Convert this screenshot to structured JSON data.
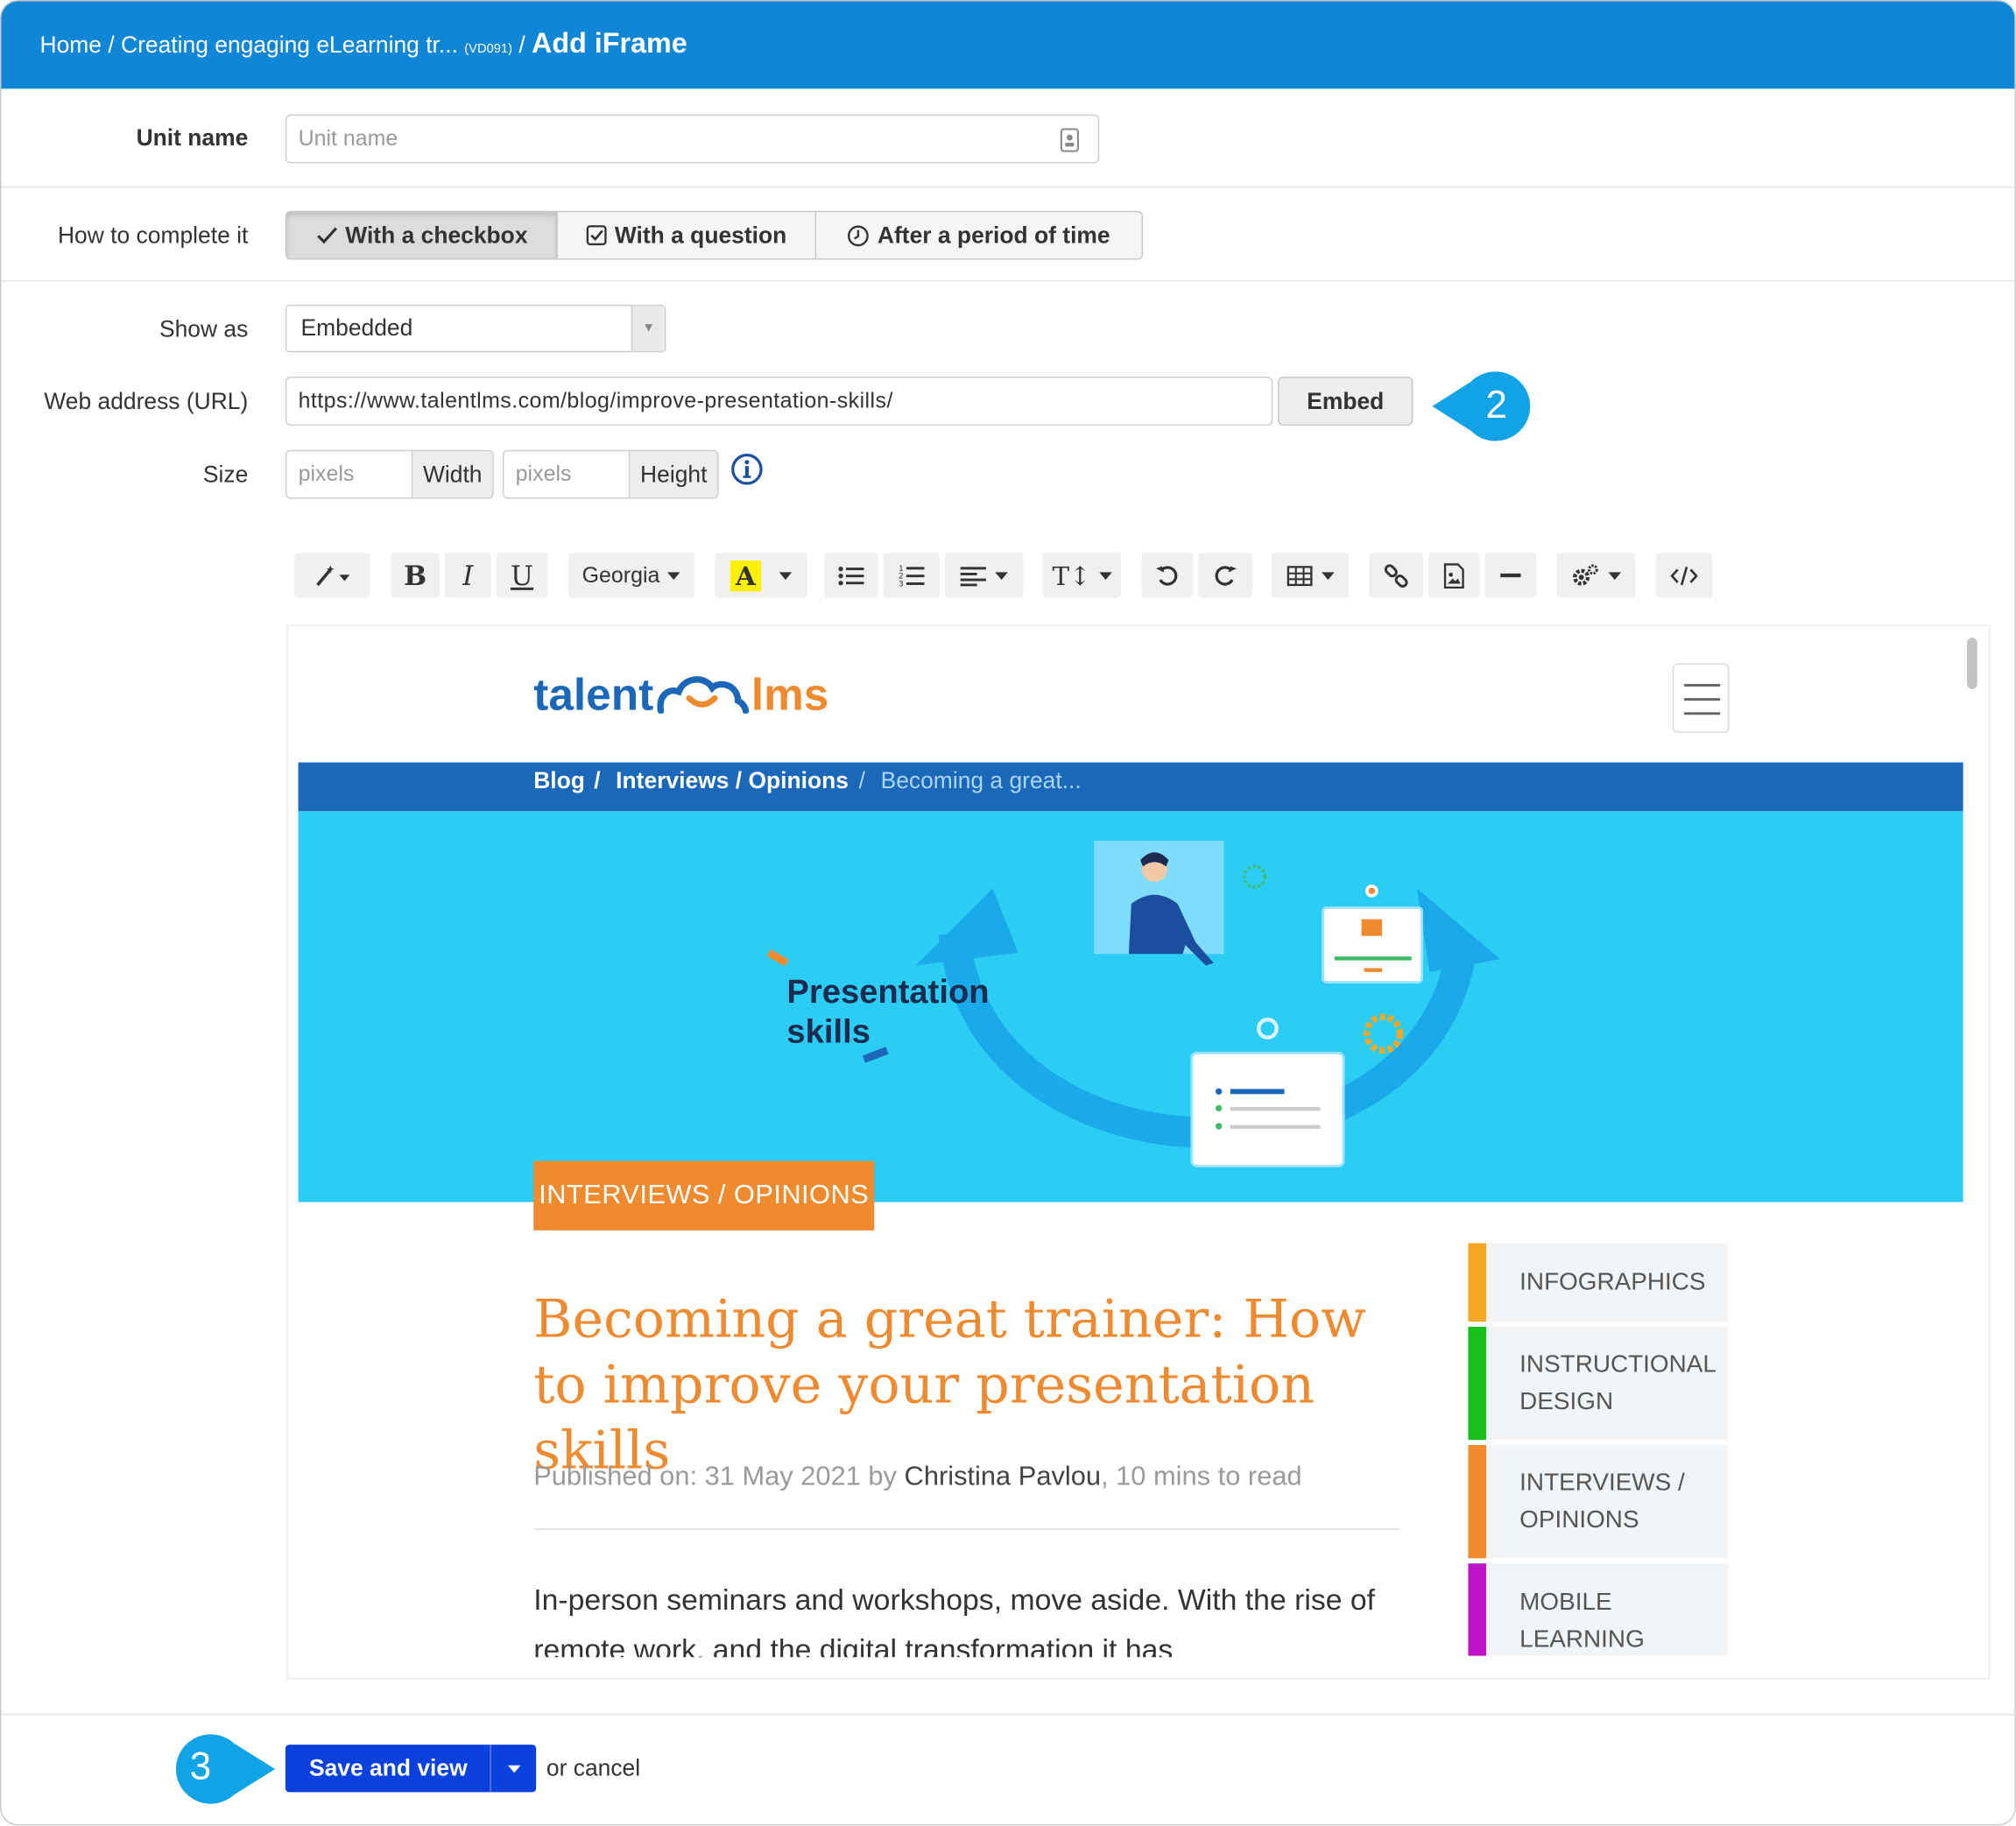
{
  "breadcrumb": {
    "home": "Home",
    "sep1": " / ",
    "course": "Creating engaging eLearning tr...",
    "course_code": "(VD091)",
    "sep2": " / ",
    "current": "Add iFrame"
  },
  "unit_name": {
    "label": "Unit name",
    "placeholder": "Unit name"
  },
  "completion": {
    "label": "How to complete it",
    "options": [
      "With a checkbox",
      "With a question",
      "After a period of time"
    ],
    "selected": 0
  },
  "show_as": {
    "label": "Show as",
    "value": "Embedded"
  },
  "url": {
    "label": "Web address (URL)",
    "value": "https://www.talentlms.com/blog/improve-presentation-skills/",
    "embed_button": "Embed"
  },
  "size": {
    "label": "Size",
    "width_placeholder": "pixels",
    "width_label": "Width",
    "height_placeholder": "pixels",
    "height_label": "Height"
  },
  "editor_toolbar": {
    "font_name": "Georgia",
    "icons": [
      "magic-wand-icon",
      "bold-icon",
      "italic-icon",
      "underline-icon",
      "font-family-dropdown",
      "text-color-icon",
      "bullet-list-icon",
      "numbered-list-icon",
      "align-icon",
      "text-size-icon",
      "undo-icon",
      "redo-icon",
      "table-icon",
      "link-icon",
      "image-icon",
      "horizontal-rule-icon",
      "settings-icon",
      "code-view-icon"
    ]
  },
  "embedded_page": {
    "logo_left": "talent",
    "logo_right": "lms",
    "breadcrumb": [
      "Blog",
      "Interviews / Opinions",
      "Becoming a great..."
    ],
    "hero_title_line1": "Presentation",
    "hero_title_line2": "skills",
    "tag": "INTERVIEWS / OPINIONS",
    "headline": "Becoming a great trainer: How to improve your presentation skills",
    "meta_prefix": "Published on: 31 May 2021 by ",
    "meta_author": "Christina Pavlou",
    "meta_suffix": ", 10 mins to read",
    "body": "In-person seminars and workshops, move aside. With the rise of remote work, and the digital transformation it has",
    "categories": [
      {
        "line1": "INFOGRAPHICS",
        "line2": "",
        "color": "#f5a623"
      },
      {
        "line1": "INSTRUCTIONAL",
        "line2": "DESIGN",
        "color": "#16c21a"
      },
      {
        "line1": "INTERVIEWS /",
        "line2": "OPINIONS",
        "color": "#f08a2e"
      },
      {
        "line1": "MOBILE",
        "line2": "LEARNING",
        "color": "#c012c9"
      }
    ]
  },
  "callouts": {
    "step2": "2",
    "step3": "3"
  },
  "footer": {
    "save_label": "Save and view",
    "cancel_text": "or cancel"
  },
  "colors": {
    "header": "#0f86d6",
    "callout": "#12a3e6",
    "save": "#0a41dd",
    "brand_blue": "#1b67b8",
    "brand_orange": "#f08a2e",
    "hero": "#2ccdf5"
  }
}
